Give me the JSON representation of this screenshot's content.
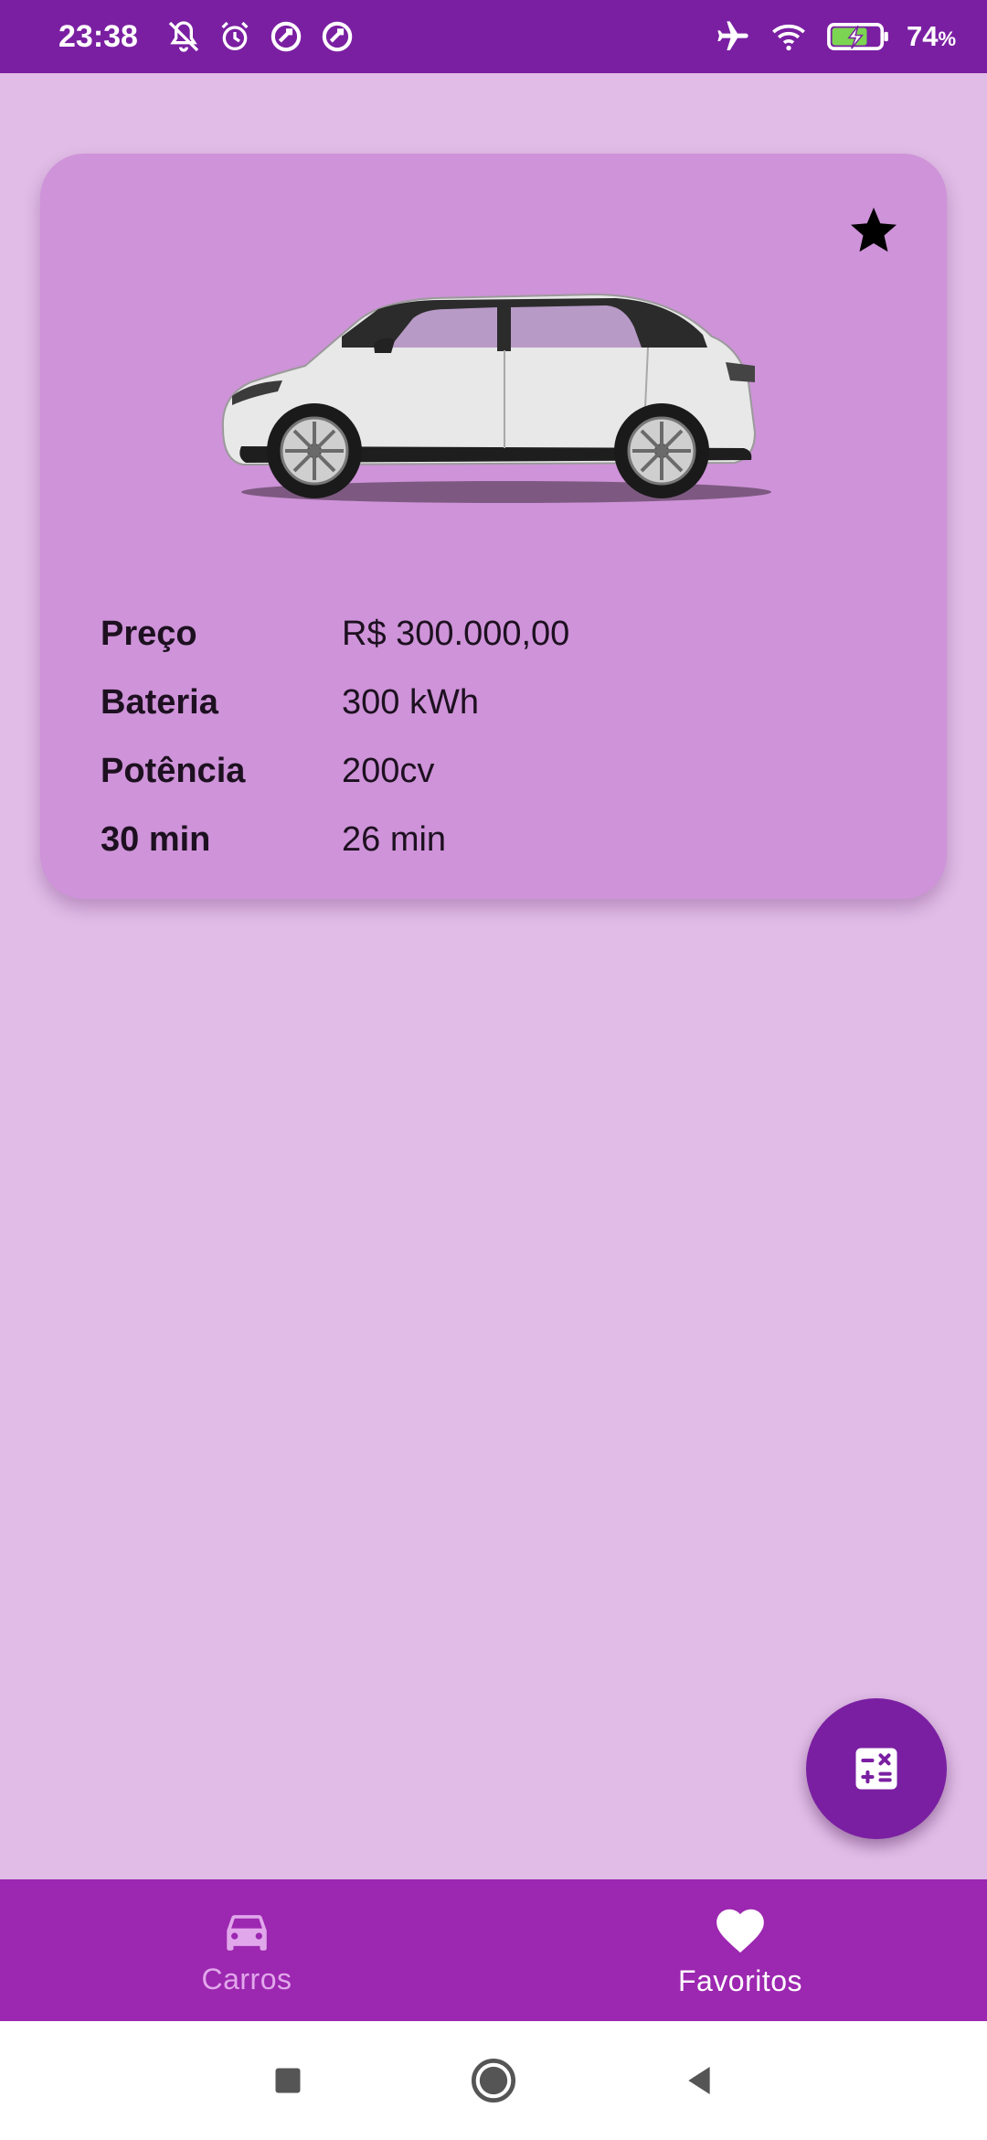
{
  "status_bar": {
    "time": "23:38",
    "battery_percent": "74",
    "battery_unit": "%",
    "icons_left": [
      "bell-off-icon",
      "alarm-icon",
      "data-saver-icon",
      "data-saver-icon"
    ],
    "icons_right": [
      "airplane-icon",
      "wifi-icon",
      "battery-charging-icon"
    ]
  },
  "car_card": {
    "favorite_icon": "star-icon",
    "image_alt": "car-image",
    "specs": [
      {
        "label": "Preço",
        "value": "R$ 300.000,00"
      },
      {
        "label": "Bateria",
        "value": "300 kWh"
      },
      {
        "label": "Potência",
        "value": "200cv"
      },
      {
        "label": "30 min",
        "value": "26 min"
      }
    ]
  },
  "fab": {
    "icon": "calculator-icon"
  },
  "bottom_nav": {
    "items": [
      {
        "label": "Carros",
        "icon": "car-icon",
        "active": false
      },
      {
        "label": "Favoritos",
        "icon": "heart-icon",
        "active": true
      }
    ]
  },
  "system_nav": {
    "buttons": [
      "recents-button",
      "home-button",
      "back-button"
    ]
  },
  "colors": {
    "status_bar": "#7A1FA2",
    "background": "#E0BCE6",
    "card": "#CE93D8",
    "bottom_nav": "#9C27B0",
    "fab": "#7A1FA2"
  }
}
